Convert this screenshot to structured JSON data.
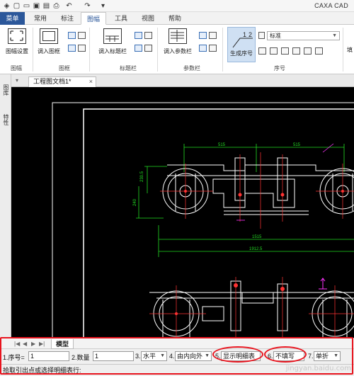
{
  "app": {
    "title": "CAXA CAD"
  },
  "quick_access": [
    {
      "icon": "new-file-icon",
      "glyph": "▢"
    },
    {
      "icon": "open-folder-icon",
      "glyph": "▭"
    },
    {
      "icon": "save-icon",
      "glyph": "▣"
    },
    {
      "icon": "save-as-icon",
      "glyph": "▤"
    },
    {
      "icon": "print-icon",
      "glyph": "⎙"
    },
    {
      "icon": "undo-icon",
      "glyph": "↶"
    },
    {
      "icon": "redo-icon",
      "glyph": "↷"
    },
    {
      "icon": "customize-dropdown-icon",
      "glyph": "▾"
    }
  ],
  "menu_button": "菜单",
  "tabs": [
    "常用",
    "标注",
    "图幅",
    "工具",
    "视图",
    "帮助"
  ],
  "active_tab": "图幅",
  "ribbon": {
    "groups": [
      {
        "label": "图幅",
        "buttons": [
          "图幅设置"
        ]
      },
      {
        "label": "图框",
        "buttons": [
          "调入图框"
        ]
      },
      {
        "label": "标题栏",
        "buttons": [
          "调入标题栏"
        ]
      },
      {
        "label": "参数栏",
        "buttons": [
          "调入参数栏"
        ]
      },
      {
        "label": "序号",
        "buttons": [
          "生成序号"
        ]
      }
    ],
    "number_style_value": "标准",
    "cut_label": "填"
  },
  "left_dock": [
    "图库",
    "特性"
  ],
  "document_tab": {
    "title": "工程图文档1*",
    "close": "×"
  },
  "drawing": {
    "dim_top_left": "515",
    "dim_top_right": "515",
    "dim_mid": "1515",
    "dim_bottom": "1912.5",
    "dim_side_a": "230.5",
    "dim_side_b": "240",
    "colors": {
      "line": "#ffffff",
      "dimension": "#22dd22",
      "center": "#ff3333",
      "leader": "#ff33ff",
      "hatch": "#ff3333"
    }
  },
  "bottom": {
    "model_tab": "模型",
    "nav_arrows": [
      "|◀",
      "◀",
      "▶",
      "▶|"
    ],
    "params": [
      {
        "label": "1.序号=",
        "value": "1"
      },
      {
        "label": "2.数量",
        "value": "1"
      },
      {
        "label": "3.",
        "value": "水平"
      },
      {
        "label": "4.",
        "value": "由内向外"
      },
      {
        "label": "5.",
        "value": "显示明细表"
      },
      {
        "label": "6.",
        "value": "不填写"
      },
      {
        "label": "7.",
        "value": "单折"
      }
    ],
    "prompt": "拾取引出点或选择明细表行:",
    "watermark": "jingyan.baidu.com"
  },
  "annotation_color": "#e8141e"
}
